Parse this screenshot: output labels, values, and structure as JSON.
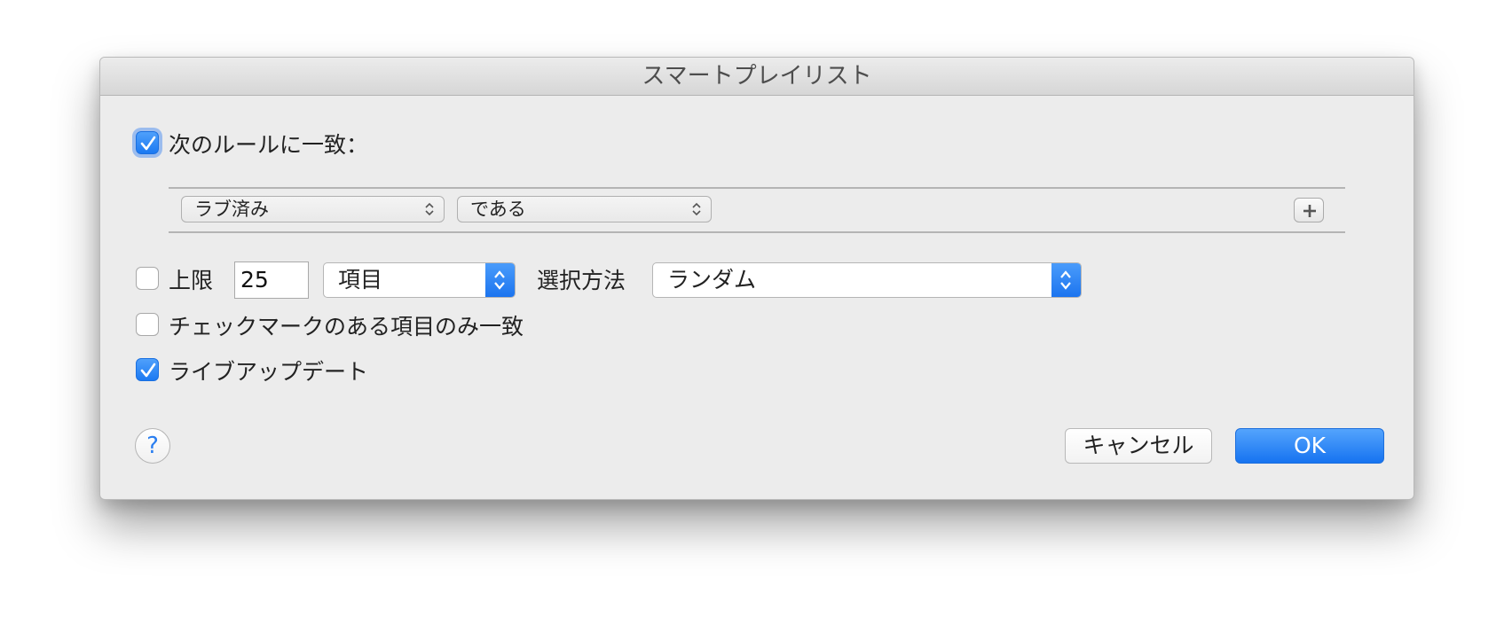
{
  "dialog": {
    "title": "スマートプレイリスト"
  },
  "match_rules": {
    "label": "次のルールに一致：",
    "checked": true
  },
  "rule": {
    "field": "ラブ済み",
    "operator": "である",
    "add_icon": "plus-icon",
    "annotation_arrow_color": "#e8401c"
  },
  "limit": {
    "label": "上限",
    "checked": false,
    "value": "25",
    "unit": "項目",
    "selection_label": "選択方法",
    "selection_value": "ランダム"
  },
  "checked_only": {
    "label": "チェックマークのある項目のみ一致",
    "checked": false
  },
  "live_update": {
    "label": "ライブアップデート",
    "checked": true
  },
  "buttons": {
    "help": "?",
    "cancel": "キャンセル",
    "ok": "OK"
  },
  "colors": {
    "accent": "#1b79f2",
    "dialog_bg": "#ececec"
  }
}
